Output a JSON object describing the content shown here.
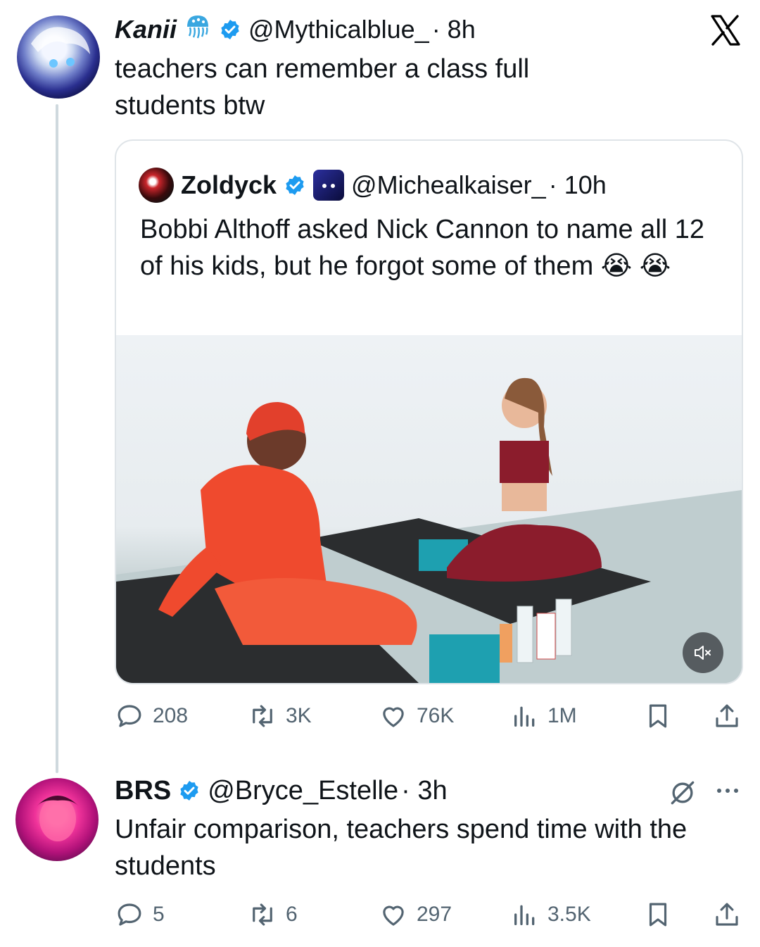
{
  "main_tweet": {
    "display_name": "Kanii",
    "handle": "@Mythicalblue_",
    "time": "· 8h",
    "text": "teachers can remember a class full students btw",
    "stats": {
      "replies": "208",
      "reposts": "3K",
      "likes": "76K",
      "views": "1M"
    }
  },
  "quoted_tweet": {
    "display_name": "Zoldyck",
    "handle": "@Michealkaiser_",
    "time": "· 10h",
    "text": "Bobbi Althoff asked Nick Cannon to name all 12 of his kids, but he forgot some of them 😭 😭"
  },
  "reply_tweet": {
    "display_name": "BRS",
    "handle": "@Bryce_Estelle",
    "time": "· 3h",
    "text": "Unfair comparison, teachers spend time with the students",
    "stats": {
      "replies": "5",
      "reposts": "6",
      "likes": "297",
      "views": "3.5K"
    }
  },
  "colors": {
    "verified": "#1d9bf0",
    "icon_gray": "#536471",
    "border": "#dfe4e8",
    "thread_line": "#cfd9de"
  },
  "icons": [
    "x-logo-icon",
    "jellyfish-emoji-icon",
    "verified-badge-icon",
    "reply-icon",
    "repost-icon",
    "like-icon",
    "views-icon",
    "bookmark-icon",
    "share-icon",
    "grok-icon",
    "more-icon",
    "mute-icon"
  ]
}
